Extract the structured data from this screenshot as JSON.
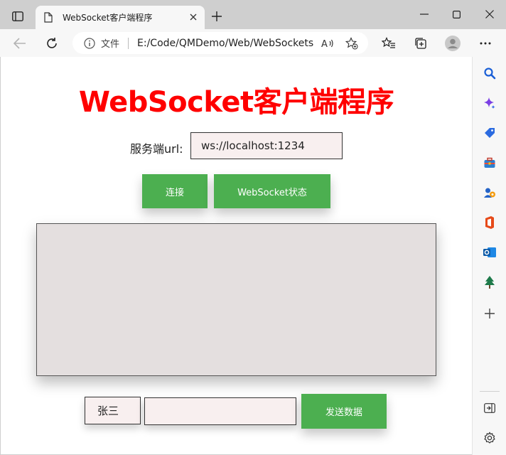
{
  "browser": {
    "tab": {
      "title": "WebSocket客户端程序"
    },
    "address": {
      "file_label": "文件",
      "url": "E:/Code/QMDemo/Web/WebSocketsExample/html/index.html"
    }
  },
  "page": {
    "title": "WebSocket客户端程序",
    "url_label": "服务端url:",
    "url_value": "ws://localhost:1234",
    "connect_button": "连接",
    "status_button": "WebSocket状态",
    "message_log": "",
    "name_value": "张三",
    "message_value": "",
    "send_button": "发送数据"
  },
  "colors": {
    "title": "#ff0000",
    "button": "#4caf50",
    "input_bg": "#f8efef",
    "log_bg": "#e4dfdf"
  }
}
